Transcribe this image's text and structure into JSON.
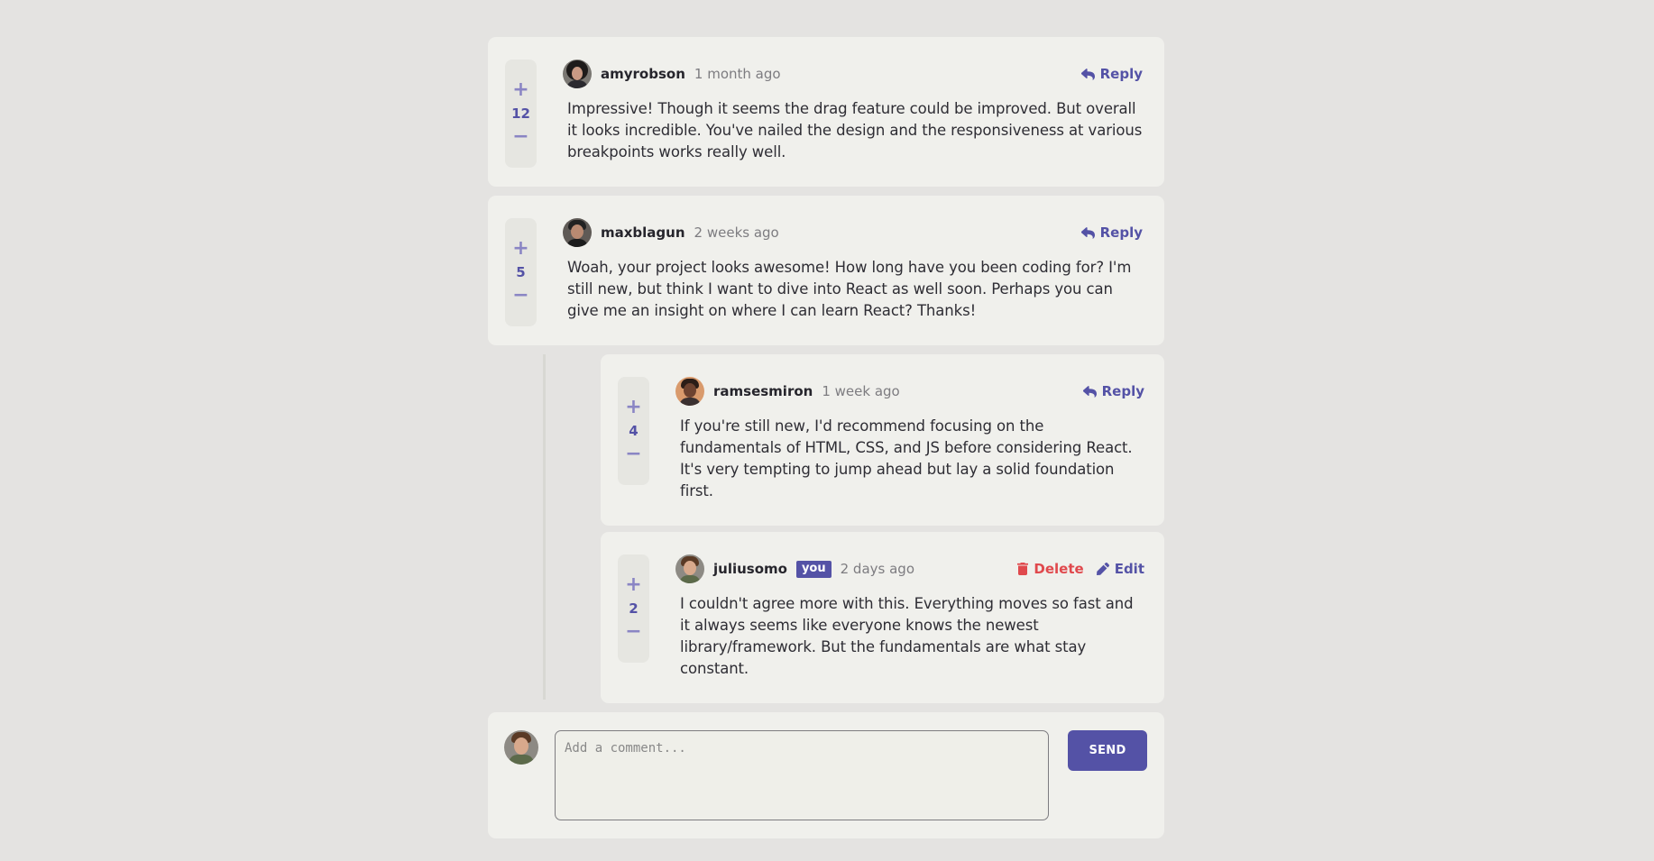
{
  "comments": [
    {
      "score": "12",
      "username": "amyrobson",
      "time": "1 month ago",
      "reply_label": "Reply",
      "text": "Impressive! Though it seems the drag feature could be improved. But overall it looks incredible. You've nailed the design and the responsiveness at various breakpoints works really well."
    },
    {
      "score": "5",
      "username": "maxblagun",
      "time": "2 weeks ago",
      "reply_label": "Reply",
      "text": "Woah, your project looks awesome! How long have you been coding for? I'm still new, but think I want to dive into React as well soon. Perhaps you can give me an insight on where I can learn React? Thanks!",
      "replies": [
        {
          "score": "4",
          "username": "ramsesmiron",
          "time": "1 week ago",
          "reply_label": "Reply",
          "text": "If you're still new, I'd recommend focusing on the fundamentals of HTML, CSS, and JS before considering React. It's very tempting to jump ahead but lay a solid foundation first."
        },
        {
          "score": "2",
          "username": "juliusomo",
          "you_badge": "you",
          "time": "2 days ago",
          "delete_label": "Delete",
          "edit_label": "Edit",
          "text": "I couldn't agree more with this. Everything moves so fast and it always seems like everyone knows the newest library/framework. But the fundamentals are what stay constant."
        }
      ]
    }
  ],
  "vote": {
    "plus": "+",
    "minus": "−"
  },
  "new_comment": {
    "placeholder": "Add a comment...",
    "send_label": "SEND"
  },
  "colors": {
    "accent": "#5452a6",
    "accent_light": "#8a85c4",
    "danger": "#e0494d",
    "card_bg": "#f0f0ec",
    "page_bg": "#e4e3e1"
  },
  "icons": {
    "reply": "reply-arrow-icon",
    "delete": "trash-icon",
    "edit": "pencil-icon"
  }
}
